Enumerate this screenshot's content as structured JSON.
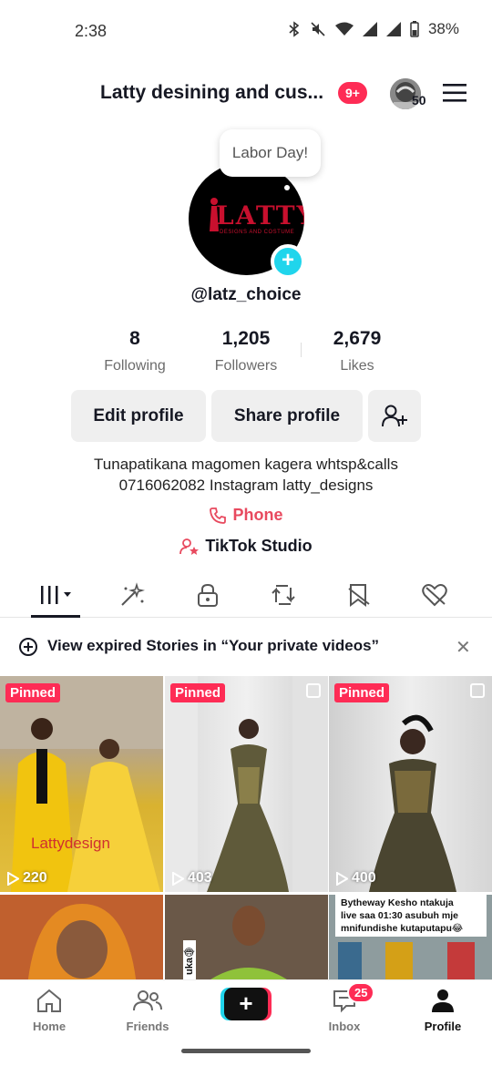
{
  "status_bar": {
    "time": "2:38",
    "battery": "38%",
    "icons": [
      "bluetooth-icon",
      "mute-icon",
      "wifi-icon",
      "signal-icon",
      "signal-icon",
      "battery-icon"
    ]
  },
  "header": {
    "title": "Latty  desining and cus...",
    "notification_badge": "9+",
    "account_switch_count": "50",
    "menu_icon": "hamburger-menu-icon"
  },
  "profile": {
    "bubble_text": "Labor Day!",
    "logo_text": "LATTY",
    "logo_subtext": "DESIGNS AND COSTUME",
    "username": "@latz_choice",
    "stats": [
      {
        "value": "8",
        "label": "Following"
      },
      {
        "value": "1,205",
        "label": "Followers"
      },
      {
        "value": "2,679",
        "label": "Likes"
      }
    ],
    "edit_profile_label": "Edit profile",
    "share_profile_label": "Share profile",
    "bio_line1": "Tunapatikana magomen kagera whtsp&calls",
    "bio_line2": "0716062082 Instagram latty_designs",
    "phone_label": "Phone",
    "studio_label": "TikTok Studio"
  },
  "tabs": [
    "videos-grid-icon",
    "reposts-sparkle-icon",
    "lock-icon",
    "repost-icon",
    "favorites-icon",
    "liked-icon"
  ],
  "stories_banner": {
    "text": "View expired Stories in “Your private videos”",
    "close": "✕"
  },
  "videos": [
    {
      "pinned": "Pinned",
      "views": "220",
      "watermark": "Lattydesign"
    },
    {
      "pinned": "Pinned",
      "views": "403"
    },
    {
      "pinned": "Pinned",
      "views": "400"
    }
  ],
  "row2_caption": {
    "line1": "Bytheway Kesho ntakuja",
    "line2": "live saa 01:30 asubuh mje",
    "line3": "mnifundishe kutaputapu😂"
  },
  "row2_side_text": "uka😂",
  "bottom_nav": {
    "home": "Home",
    "friends": "Friends",
    "create": "+",
    "inbox": "Inbox",
    "inbox_badge": "25",
    "profile": "Profile"
  },
  "colors": {
    "accent_red": "#fe2c55",
    "accent_cyan": "#20d5ec",
    "phone_pink": "#e84a5f"
  }
}
